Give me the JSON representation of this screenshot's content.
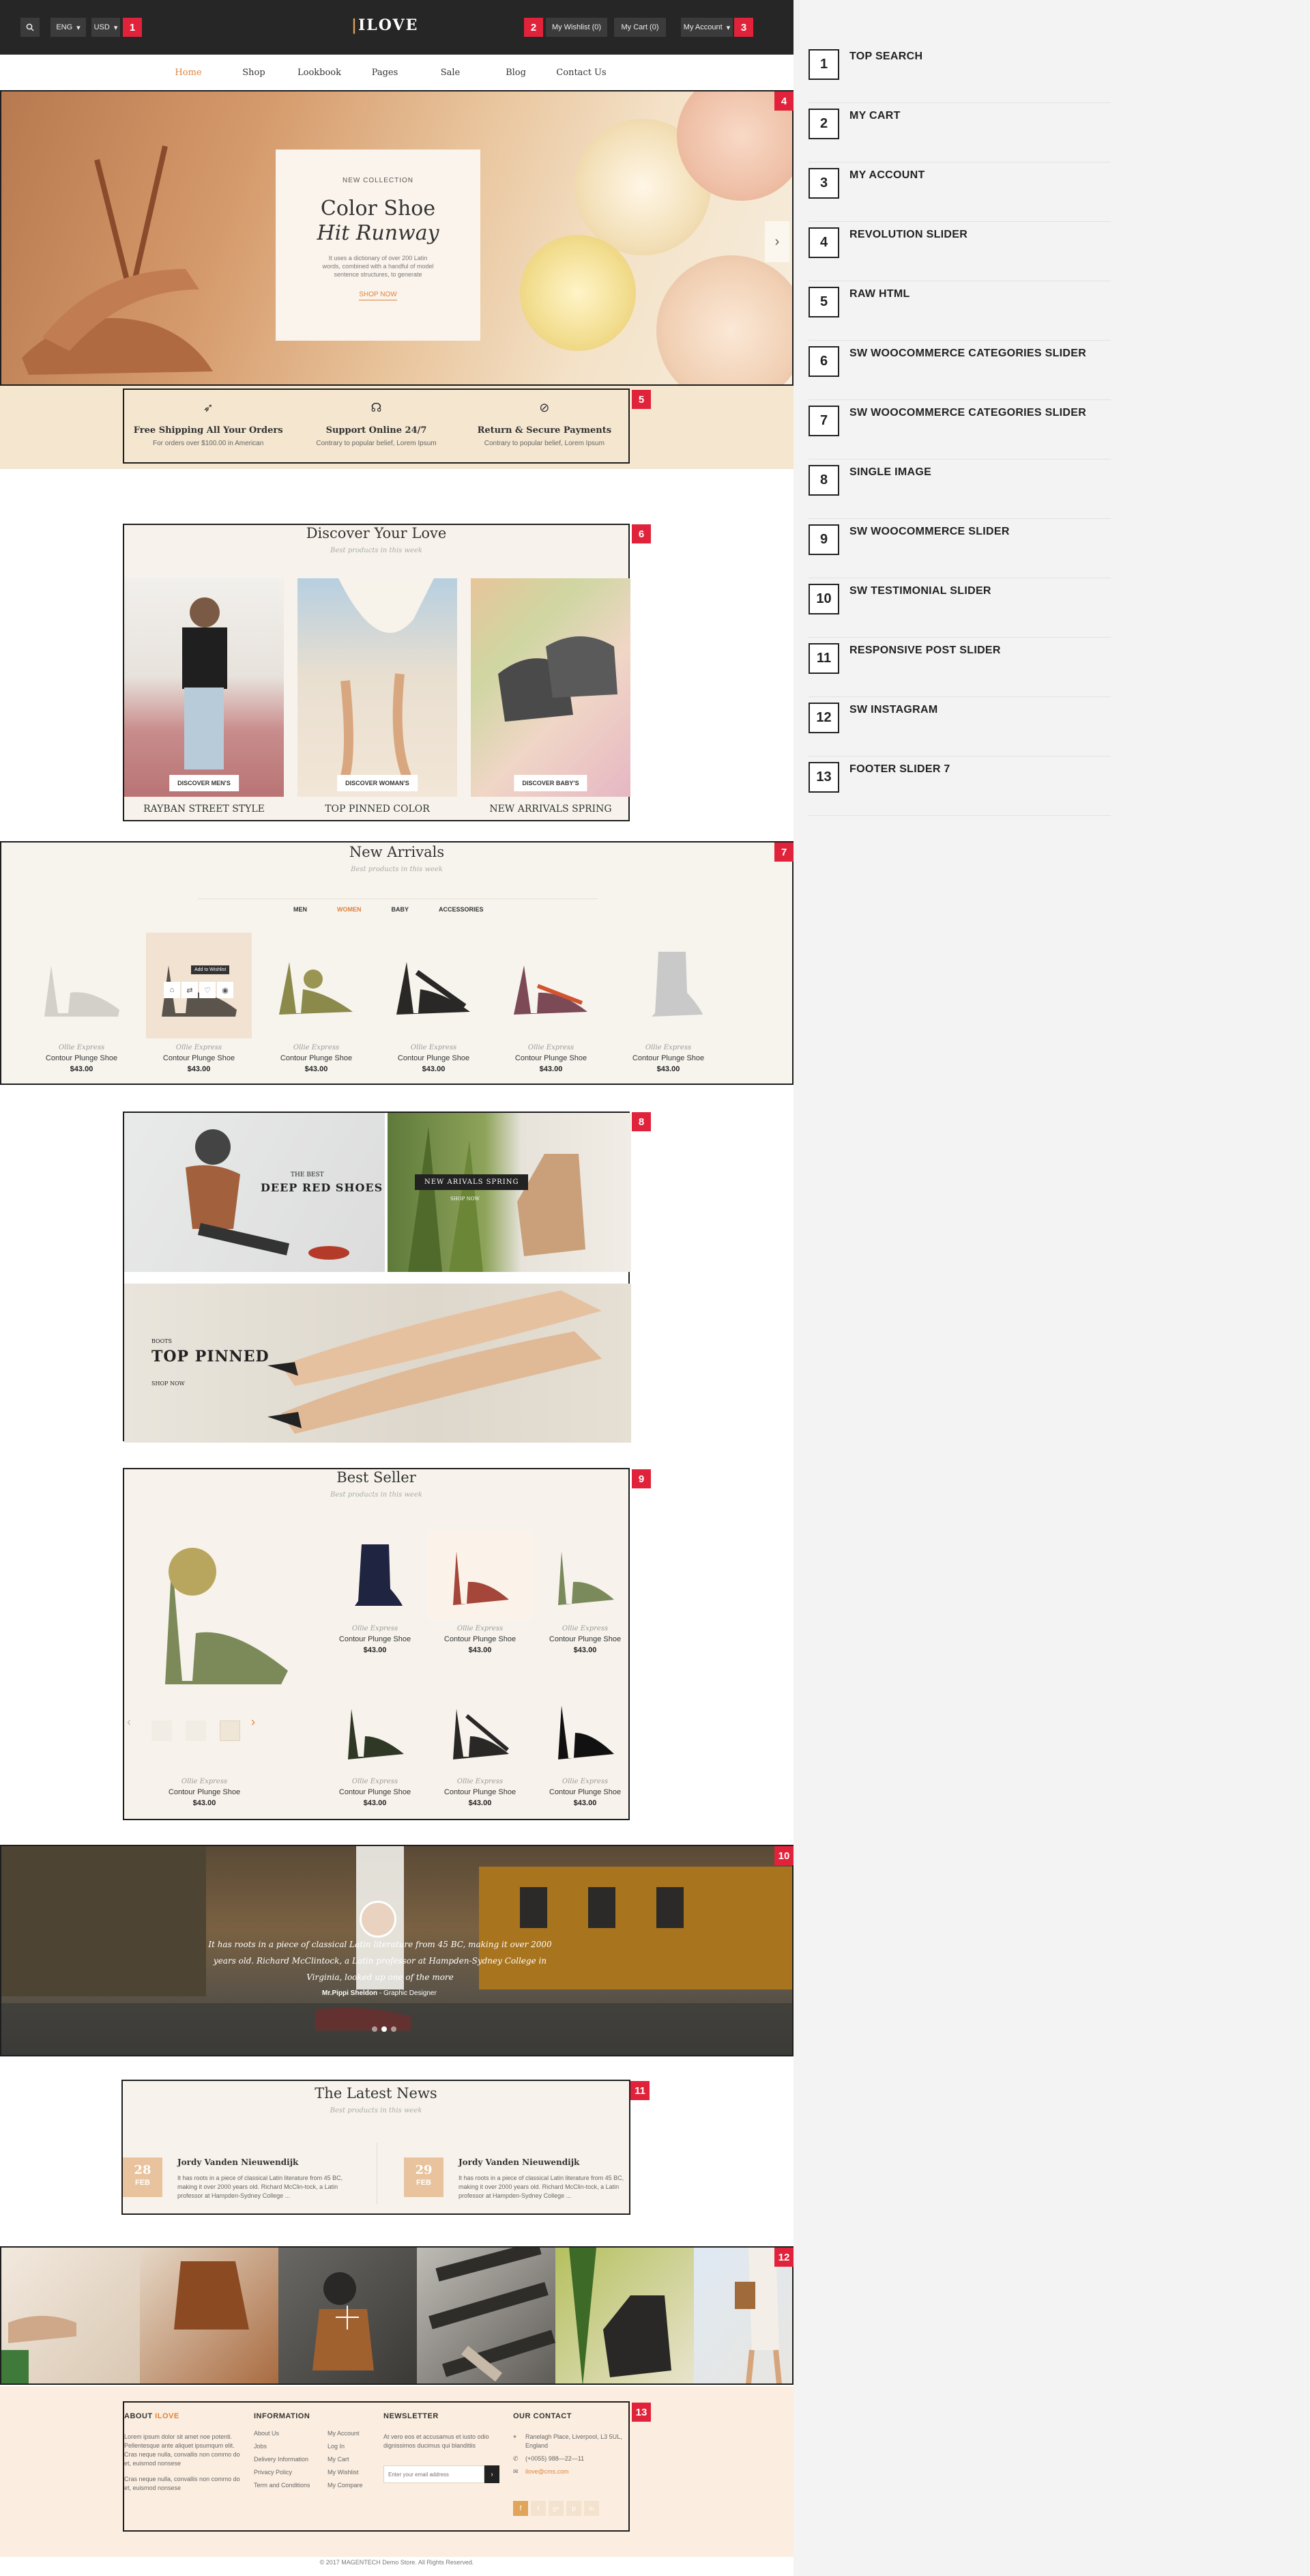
{
  "header": {
    "search_icon": "search-icon",
    "language": "ENG",
    "currency": "USD",
    "logo_text": "ILOVE",
    "wishlist": "My Wishlist (0)",
    "cart": "My Cart (0)",
    "account": "My Account"
  },
  "nav": {
    "items": [
      "Home",
      "Shop",
      "Lookbook",
      "Pages",
      "Sale",
      "Blog",
      "Contact Us"
    ],
    "active": "Home"
  },
  "hero": {
    "kicker": "NEW COLLECTION",
    "title_line1": "Color Shoe",
    "title_line2": "Hit Runway",
    "text": "It uses a dictionary of over 200 Latin words, combined with a handful of model sentence structures, to generate",
    "cta": "SHOP NOW"
  },
  "services": [
    {
      "icon": "rocket-icon",
      "title": "Free Shipping All Your Orders",
      "sub": "For orders over $100.00 in American"
    },
    {
      "icon": "headphones-icon",
      "title": "Support Online 24/7",
      "sub": "Contrary to popular belief, Lorem Ipsum"
    },
    {
      "icon": "secure-icon",
      "title": "Return & Secure Payments",
      "sub": "Contrary to popular belief, Lorem Ipsum"
    }
  ],
  "categories": {
    "title": "Discover Your Love",
    "sub": "Best products in this week",
    "items": [
      {
        "tag": "DISCOVER MEN'S",
        "label": "RAYBAN STREET STYLE"
      },
      {
        "tag": "DISCOVER WOMAN'S",
        "label": "TOP PINNED COLOR"
      },
      {
        "tag": "DISCOVER BABY'S",
        "label": "NEW ARRIVALS SPRING"
      }
    ]
  },
  "arrivals": {
    "title": "New Arrivals",
    "sub": "Best products in this week",
    "tabs": [
      "MEN",
      "WOMEN",
      "BABY",
      "ACCESSORIES"
    ],
    "active_tab": "WOMEN",
    "add_to_wishlist": "Add to Wishlist",
    "products": [
      {
        "brand": "Ollie Express",
        "name": "Contour Plunge Shoe",
        "price": "$43.00"
      },
      {
        "brand": "Ollie Express",
        "name": "Contour Plunge Shoe",
        "price": "$43.00"
      },
      {
        "brand": "Ollie Express",
        "name": "Contour Plunge Shoe",
        "price": "$43.00"
      },
      {
        "brand": "Ollie Express",
        "name": "Contour Plunge Shoe",
        "price": "$43.00"
      },
      {
        "brand": "Ollie Express",
        "name": "Contour Plunge Shoe",
        "price": "$43.00"
      },
      {
        "brand": "Ollie Express",
        "name": "Contour Plunge Shoe",
        "price": "$43.00"
      }
    ]
  },
  "banners": {
    "b1_kicker": "THE BEST",
    "b1_title": "DEEP RED SHOES",
    "b1_cta": "SHOP NOW",
    "b2_title": "NEW ARIVALS SPRING",
    "b2_cta": "SHOP NOW",
    "b3_kicker": "BOOTS",
    "b3_title": "TOP PINNED",
    "b3_cta": "SHOP NOW"
  },
  "bestseller": {
    "title": "Best Seller",
    "sub": "Best products in this week",
    "products": [
      {
        "brand": "Ollie Express",
        "name": "Contour Plunge Shoe",
        "price": "$43.00"
      },
      {
        "brand": "Ollie Express",
        "name": "Contour Plunge Shoe",
        "price": "$43.00"
      },
      {
        "brand": "Ollie Express",
        "name": "Contour Plunge Shoe",
        "price": "$43.00"
      },
      {
        "brand": "Ollie Express",
        "name": "Contour Plunge Shoe",
        "price": "$43.00"
      },
      {
        "brand": "Ollie Express",
        "name": "Contour Plunge Shoe",
        "price": "$43.00"
      },
      {
        "brand": "Ollie Express",
        "name": "Contour Plunge Shoe",
        "price": "$43.00"
      },
      {
        "brand": "Ollie Express",
        "name": "Contour Plunge Shoe",
        "price": "$43.00"
      }
    ]
  },
  "testimonial": {
    "quote": "It has roots in a piece of classical Latin literature from 45 BC, making it over 2000 years old. Richard McClintock, a Latin professor at Hampden-Sydney College in Virginia, looked up one of the more",
    "author": "Mr.Pippi Sheldon",
    "role": "- Graphic Designer"
  },
  "news": {
    "title": "The Latest News",
    "sub": "Best products in this week",
    "posts": [
      {
        "day": "28",
        "month": "FEB",
        "title": "Jordy Vanden Nieuwendijk",
        "excerpt": "It has roots in a piece of classical Latin literature from 45 BC, making it over 2000 years old. Richard McClin-tock, a Latin professor at Hampden-Sydney College ..."
      },
      {
        "day": "29",
        "month": "FEB",
        "title": "Jordy Vanden Nieuwendijk",
        "excerpt": "It has roots in a piece of classical Latin literature from 45 BC, making it over 2000 years old. Richard McClin-tock, a Latin professor at Hampden-Sydney College ..."
      }
    ]
  },
  "footer": {
    "about_title": "ABOUT",
    "about_brand": "ILOVE",
    "about_text1": "Lorem ipsum dolor sit amet noe potenti. Pellentesque ante aliquet ipsumqum elit. Cras neque nulla, convallis non commo do et, euismod nonsese",
    "about_text2": "Cras neque nulla, convallis non commo do et, euismod nonsese",
    "info_title": "INFORMATION",
    "info_col1": [
      "About Us",
      "Jobs",
      "Delivery Information",
      "Privacy Policy",
      "Term and Conditions"
    ],
    "info_col2": [
      "My Account",
      "Log In",
      "My Cart",
      "My Wishlist",
      "My Compare"
    ],
    "newsletter_title": "NEWSLETTER",
    "newsletter_text": "At vero eos et accusamus et iusto odio dignissimos ducimus qui blanditiis",
    "newsletter_placeholder": "Enter your email address",
    "contact_title": "OUR CONTACT",
    "address": "Ranelagh Place, Liverpool, L3 5UL, England",
    "phone": "(+0055) 988—22—11",
    "email": "ilove@cms.com",
    "social": [
      "f",
      "t",
      "g+",
      "p",
      "in"
    ],
    "copyright": "© 2017 MAGENTECH Demo Store. All Rights Reserved."
  },
  "badges": [
    "1",
    "2",
    "3",
    "4",
    "5",
    "6",
    "7",
    "8",
    "9",
    "10",
    "11",
    "12",
    "13"
  ],
  "legend": [
    {
      "num": "1",
      "label": "TOP SEARCH"
    },
    {
      "num": "2",
      "label": "MY CART"
    },
    {
      "num": "3",
      "label": "MY ACCOUNT"
    },
    {
      "num": "4",
      "label": "REVOLUTION SLIDER"
    },
    {
      "num": "5",
      "label": "RAW HTML"
    },
    {
      "num": "6",
      "label": "SW WOOCOMMERCE CATEGORIES SLIDER"
    },
    {
      "num": "7",
      "label": "SW WOOCOMMERCE CATEGORIES SLIDER"
    },
    {
      "num": "8",
      "label": "SINGLE IMAGE"
    },
    {
      "num": "9",
      "label": "SW WOOCOMMERCE SLIDER"
    },
    {
      "num": "10",
      "label": "SW TESTIMONIAL SLIDER"
    },
    {
      "num": "11",
      "label": "RESPONSIVE POST SLIDER"
    },
    {
      "num": "12",
      "label": "SW INSTAGRAM"
    },
    {
      "num": "13",
      "label": "FOOTER SLIDER 7"
    }
  ]
}
